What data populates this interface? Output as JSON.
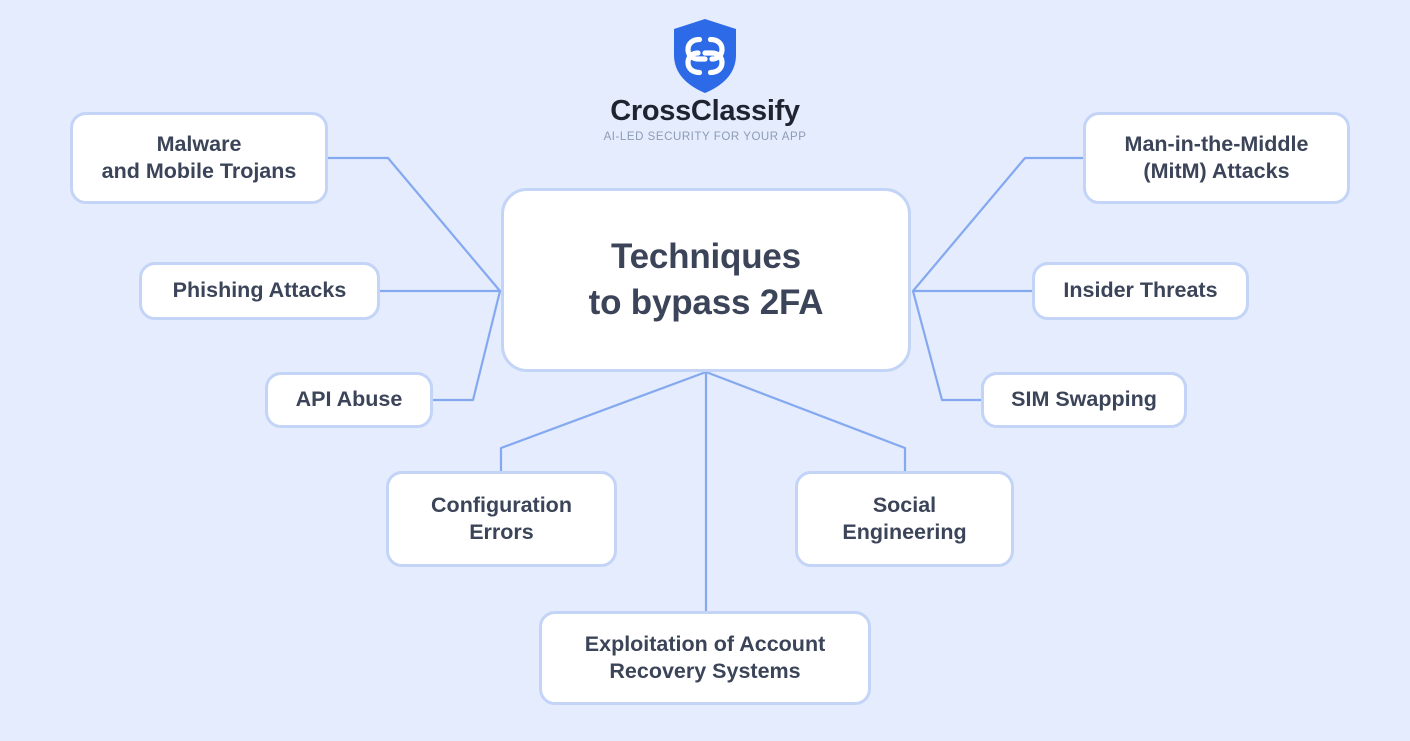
{
  "brand": {
    "name": "CrossClassify",
    "tagline": "AI-LED SECURITY FOR YOUR APP",
    "logo_icon": "shield-interlocked-links-icon",
    "logo_color": "#2d6ae8"
  },
  "theme": {
    "background": "#e4ecfd",
    "node_fill": "#ffffff",
    "node_border": "#c3d4f7",
    "connector": "#85a9f0",
    "text": "#3b4458",
    "tagline_text": "#8d9bb4"
  },
  "diagram": {
    "type": "mind-map",
    "center": {
      "id": "center",
      "label": "Techniques\nto bypass 2FA"
    },
    "branches": [
      {
        "id": "malware",
        "label": "Malware\nand Mobile Trojans",
        "side": "left"
      },
      {
        "id": "phishing",
        "label": "Phishing Attacks",
        "side": "left"
      },
      {
        "id": "api",
        "label": "API Abuse",
        "side": "left"
      },
      {
        "id": "mitm",
        "label": "Man-in-the-Middle\n(MitM) Attacks",
        "side": "right"
      },
      {
        "id": "insider",
        "label": "Insider Threats",
        "side": "right"
      },
      {
        "id": "sim",
        "label": "SIM Swapping",
        "side": "right"
      },
      {
        "id": "config",
        "label": "Configuration\nErrors",
        "side": "bottom"
      },
      {
        "id": "social",
        "label": "Social\nEngineering",
        "side": "bottom"
      },
      {
        "id": "recovery",
        "label": "Exploitation of Account\nRecovery Systems",
        "side": "bottom"
      }
    ]
  }
}
